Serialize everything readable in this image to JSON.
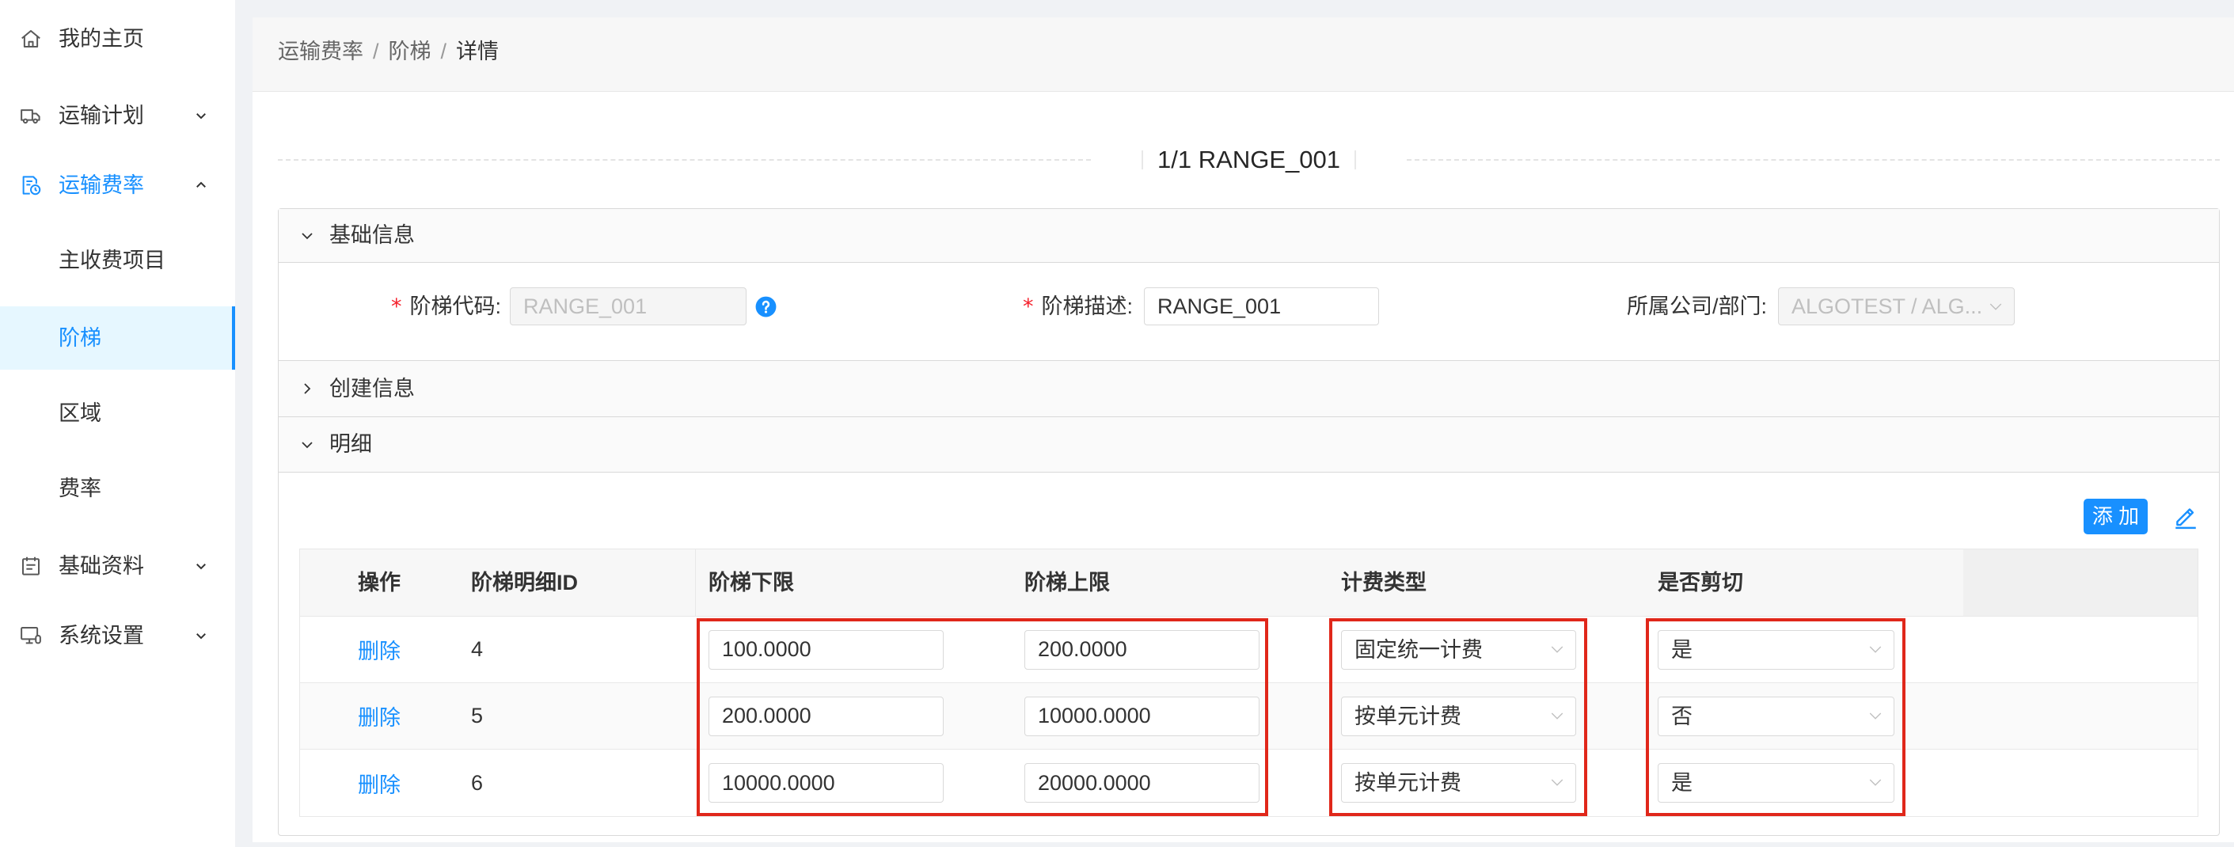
{
  "colors": {
    "primary": "#1890ff",
    "required": "#f5222d",
    "annotation": "#e0271a",
    "selected_menu_bg": "#e6f7ff"
  },
  "sidebar": {
    "items": [
      {
        "label": "我的主页",
        "icon": "home-icon"
      },
      {
        "label": "运输计划",
        "icon": "truck-icon",
        "expanded": false
      },
      {
        "label": "运输费率",
        "icon": "rate-sheet-icon",
        "expanded": true,
        "active": true
      },
      {
        "label": "主收费项目"
      },
      {
        "label": "阶梯",
        "selected": true
      },
      {
        "label": "区域"
      },
      {
        "label": "费率"
      },
      {
        "label": "基础资料",
        "icon": "clipboard-icon",
        "expanded": false
      },
      {
        "label": "系统设置",
        "icon": "monitor-icon",
        "expanded": false
      }
    ]
  },
  "breadcrumb": {
    "items": [
      "运输费率",
      "阶梯",
      "详情"
    ],
    "separator": "/"
  },
  "title": "1/1 RANGE_001",
  "panels": [
    {
      "title": "基础信息",
      "expanded": true
    },
    {
      "title": "创建信息",
      "expanded": false
    },
    {
      "title": "明细",
      "expanded": true
    }
  ],
  "basic_info": {
    "required_mark": "*",
    "fields": [
      {
        "label": "阶梯代码:",
        "value": "RANGE_001",
        "required": true,
        "disabled": true,
        "help_icon": "question-circle-icon"
      },
      {
        "label": "阶梯描述:",
        "value": "RANGE_001",
        "required": true,
        "disabled": false
      },
      {
        "label": "所属公司/部门:",
        "value": "ALGOTEST / ALG...",
        "required": false,
        "disabled": true
      }
    ]
  },
  "detail": {
    "add_button": "添 加",
    "edit_icon": "edit-icon",
    "columns": [
      "操作",
      "阶梯明细ID",
      "阶梯下限",
      "阶梯上限",
      "计费类型",
      "是否剪切"
    ],
    "rows": [
      {
        "action": "删除",
        "id": "4",
        "lower": "100.0000",
        "upper": "200.0000",
        "charge_type": "固定统一计费",
        "cut": "是"
      },
      {
        "action": "删除",
        "id": "5",
        "lower": "200.0000",
        "upper": "10000.0000",
        "charge_type": "按单元计费",
        "cut": "否"
      },
      {
        "action": "删除",
        "id": "6",
        "lower": "10000.0000",
        "upper": "20000.0000",
        "charge_type": "按单元计费",
        "cut": "是"
      }
    ]
  }
}
